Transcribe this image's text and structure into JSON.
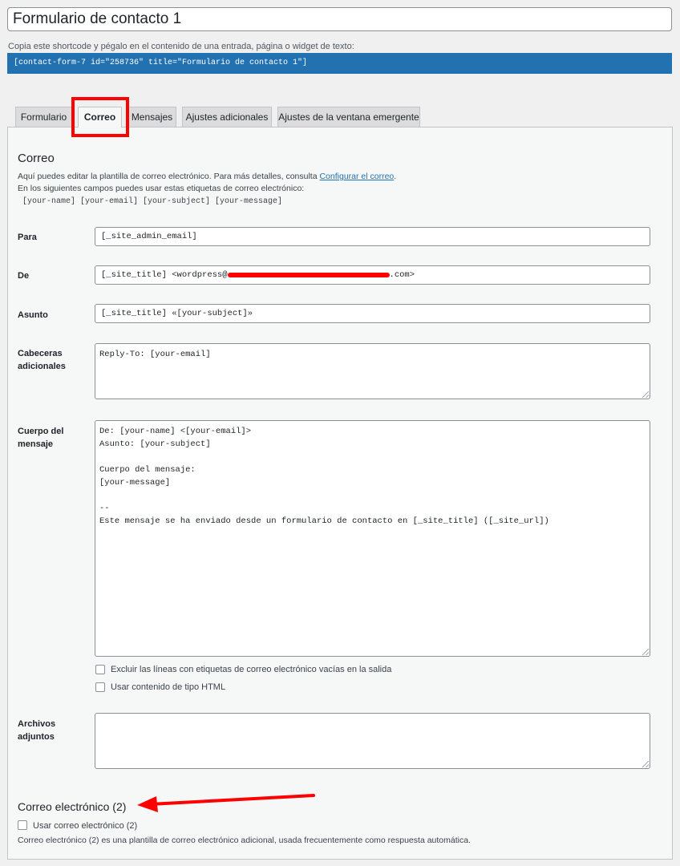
{
  "form_title": "Formulario de contacto 1",
  "shortcode": {
    "help": "Copia este shortcode y pégalo en el contenido de una entrada, página o widget de texto:",
    "code": "[contact-form-7 id=\"258736\" title=\"Formulario de contacto 1\"]"
  },
  "tabs": [
    {
      "label": "Formulario"
    },
    {
      "label": "Correo"
    },
    {
      "label": "Mensajes"
    },
    {
      "label": "Ajustes adicionales"
    },
    {
      "label": "Ajustes de la ventana emergente"
    }
  ],
  "mail": {
    "heading": "Correo",
    "desc_prefix": "Aquí puedes editar la plantilla de correo electrónico. Para más detalles, consulta ",
    "desc_link": "Configurar el correo",
    "desc_suffix": ".",
    "tags_intro": "En los siguientes campos puedes usar estas etiquetas de correo electrónico:",
    "tags": "[your-name] [your-email] [your-subject] [your-message]",
    "to_label": "Para",
    "to_value": "[_site_admin_email]",
    "from_label": "De",
    "from_value_prefix": "[_site_title] <wordpress@",
    "from_value_suffix": ".com>",
    "subject_label": "Asunto",
    "subject_value": "[_site_title] «[your-subject]»",
    "headers_label_1": "Cabeceras",
    "headers_label_2": "adicionales",
    "headers_value": "Reply-To: [your-email]",
    "body_label_1": "Cuerpo del",
    "body_label_2": "mensaje",
    "body_value": "De: [your-name] <[your-email]>\nAsunto: [your-subject]\n\nCuerpo del mensaje:\n[your-message]\n\n--\nEste mensaje se ha enviado desde un formulario de contacto en [_site_title] ([_site_url])",
    "exclude_blank_label": "Excluir las líneas con etiquetas de correo electrónico vacías en la salida",
    "use_html_label": "Usar contenido de tipo HTML",
    "attachments_label_1": "Archivos",
    "attachments_label_2": "adjuntos",
    "attachments_value": ""
  },
  "mail2": {
    "heading": "Correo electrónico (2)",
    "use_label": "Usar correo electrónico (2)",
    "desc": "Correo electrónico (2) es una plantilla de correo electrónico adicional, usada frecuentemente como respuesta automática."
  },
  "colors": {
    "shortcode_bg": "#2271b1",
    "annotation": "#ff0000",
    "link": "#2271b1"
  }
}
